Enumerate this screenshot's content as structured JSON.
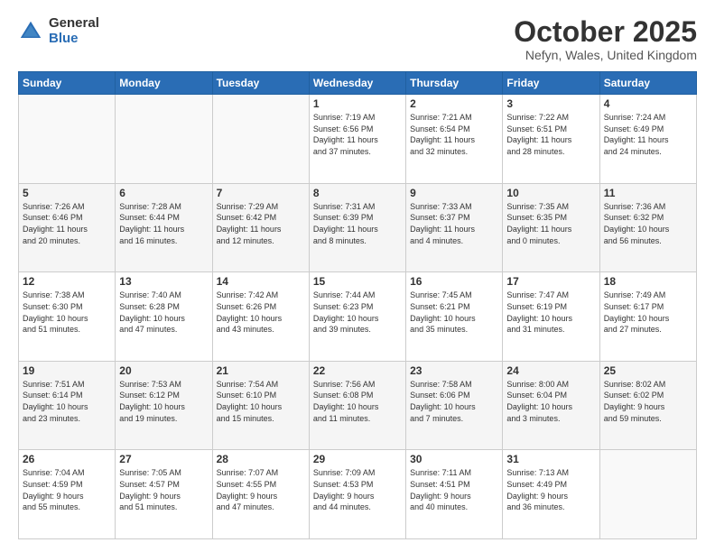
{
  "logo": {
    "general": "General",
    "blue": "Blue"
  },
  "header": {
    "month": "October 2025",
    "location": "Nefyn, Wales, United Kingdom"
  },
  "weekdays": [
    "Sunday",
    "Monday",
    "Tuesday",
    "Wednesday",
    "Thursday",
    "Friday",
    "Saturday"
  ],
  "weeks": [
    [
      {
        "day": "",
        "info": ""
      },
      {
        "day": "",
        "info": ""
      },
      {
        "day": "",
        "info": ""
      },
      {
        "day": "1",
        "info": "Sunrise: 7:19 AM\nSunset: 6:56 PM\nDaylight: 11 hours\nand 37 minutes."
      },
      {
        "day": "2",
        "info": "Sunrise: 7:21 AM\nSunset: 6:54 PM\nDaylight: 11 hours\nand 32 minutes."
      },
      {
        "day": "3",
        "info": "Sunrise: 7:22 AM\nSunset: 6:51 PM\nDaylight: 11 hours\nand 28 minutes."
      },
      {
        "day": "4",
        "info": "Sunrise: 7:24 AM\nSunset: 6:49 PM\nDaylight: 11 hours\nand 24 minutes."
      }
    ],
    [
      {
        "day": "5",
        "info": "Sunrise: 7:26 AM\nSunset: 6:46 PM\nDaylight: 11 hours\nand 20 minutes."
      },
      {
        "day": "6",
        "info": "Sunrise: 7:28 AM\nSunset: 6:44 PM\nDaylight: 11 hours\nand 16 minutes."
      },
      {
        "day": "7",
        "info": "Sunrise: 7:29 AM\nSunset: 6:42 PM\nDaylight: 11 hours\nand 12 minutes."
      },
      {
        "day": "8",
        "info": "Sunrise: 7:31 AM\nSunset: 6:39 PM\nDaylight: 11 hours\nand 8 minutes."
      },
      {
        "day": "9",
        "info": "Sunrise: 7:33 AM\nSunset: 6:37 PM\nDaylight: 11 hours\nand 4 minutes."
      },
      {
        "day": "10",
        "info": "Sunrise: 7:35 AM\nSunset: 6:35 PM\nDaylight: 11 hours\nand 0 minutes."
      },
      {
        "day": "11",
        "info": "Sunrise: 7:36 AM\nSunset: 6:32 PM\nDaylight: 10 hours\nand 56 minutes."
      }
    ],
    [
      {
        "day": "12",
        "info": "Sunrise: 7:38 AM\nSunset: 6:30 PM\nDaylight: 10 hours\nand 51 minutes."
      },
      {
        "day": "13",
        "info": "Sunrise: 7:40 AM\nSunset: 6:28 PM\nDaylight: 10 hours\nand 47 minutes."
      },
      {
        "day": "14",
        "info": "Sunrise: 7:42 AM\nSunset: 6:26 PM\nDaylight: 10 hours\nand 43 minutes."
      },
      {
        "day": "15",
        "info": "Sunrise: 7:44 AM\nSunset: 6:23 PM\nDaylight: 10 hours\nand 39 minutes."
      },
      {
        "day": "16",
        "info": "Sunrise: 7:45 AM\nSunset: 6:21 PM\nDaylight: 10 hours\nand 35 minutes."
      },
      {
        "day": "17",
        "info": "Sunrise: 7:47 AM\nSunset: 6:19 PM\nDaylight: 10 hours\nand 31 minutes."
      },
      {
        "day": "18",
        "info": "Sunrise: 7:49 AM\nSunset: 6:17 PM\nDaylight: 10 hours\nand 27 minutes."
      }
    ],
    [
      {
        "day": "19",
        "info": "Sunrise: 7:51 AM\nSunset: 6:14 PM\nDaylight: 10 hours\nand 23 minutes."
      },
      {
        "day": "20",
        "info": "Sunrise: 7:53 AM\nSunset: 6:12 PM\nDaylight: 10 hours\nand 19 minutes."
      },
      {
        "day": "21",
        "info": "Sunrise: 7:54 AM\nSunset: 6:10 PM\nDaylight: 10 hours\nand 15 minutes."
      },
      {
        "day": "22",
        "info": "Sunrise: 7:56 AM\nSunset: 6:08 PM\nDaylight: 10 hours\nand 11 minutes."
      },
      {
        "day": "23",
        "info": "Sunrise: 7:58 AM\nSunset: 6:06 PM\nDaylight: 10 hours\nand 7 minutes."
      },
      {
        "day": "24",
        "info": "Sunrise: 8:00 AM\nSunset: 6:04 PM\nDaylight: 10 hours\nand 3 minutes."
      },
      {
        "day": "25",
        "info": "Sunrise: 8:02 AM\nSunset: 6:02 PM\nDaylight: 9 hours\nand 59 minutes."
      }
    ],
    [
      {
        "day": "26",
        "info": "Sunrise: 7:04 AM\nSunset: 4:59 PM\nDaylight: 9 hours\nand 55 minutes."
      },
      {
        "day": "27",
        "info": "Sunrise: 7:05 AM\nSunset: 4:57 PM\nDaylight: 9 hours\nand 51 minutes."
      },
      {
        "day": "28",
        "info": "Sunrise: 7:07 AM\nSunset: 4:55 PM\nDaylight: 9 hours\nand 47 minutes."
      },
      {
        "day": "29",
        "info": "Sunrise: 7:09 AM\nSunset: 4:53 PM\nDaylight: 9 hours\nand 44 minutes."
      },
      {
        "day": "30",
        "info": "Sunrise: 7:11 AM\nSunset: 4:51 PM\nDaylight: 9 hours\nand 40 minutes."
      },
      {
        "day": "31",
        "info": "Sunrise: 7:13 AM\nSunset: 4:49 PM\nDaylight: 9 hours\nand 36 minutes."
      },
      {
        "day": "",
        "info": ""
      }
    ]
  ]
}
